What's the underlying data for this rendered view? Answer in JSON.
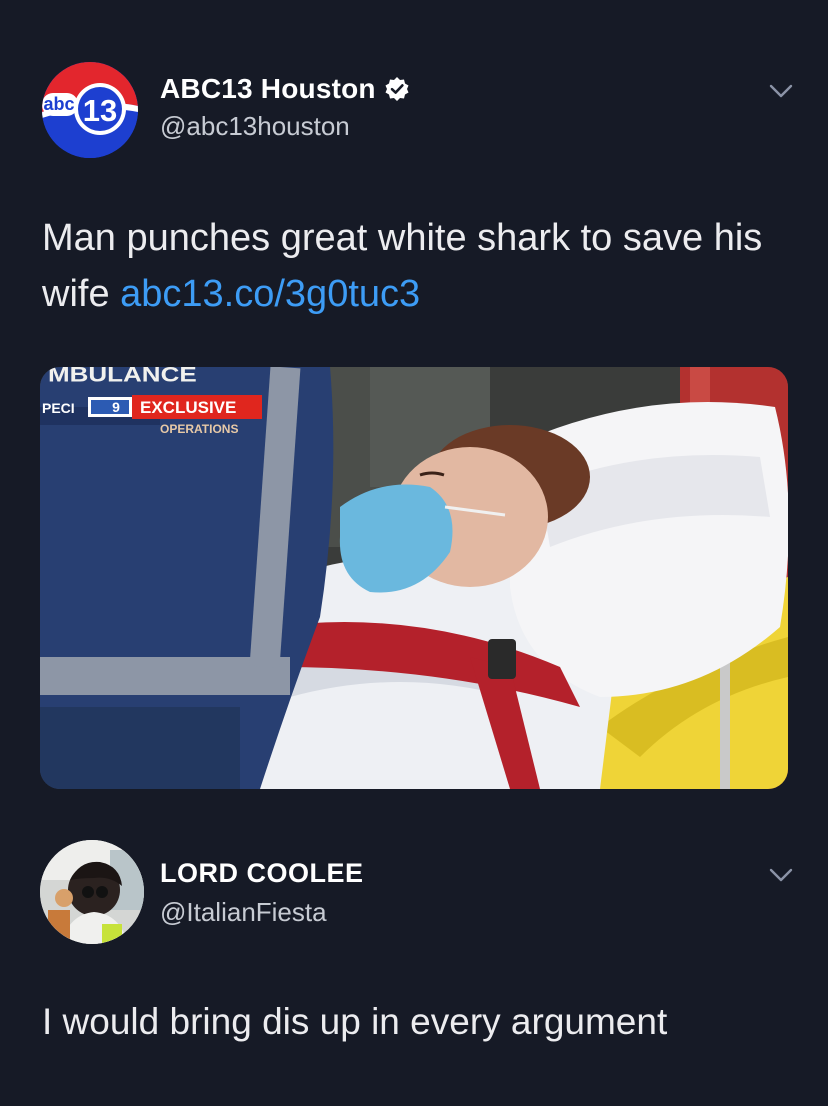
{
  "tweets": [
    {
      "display_name": "ABC13 Houston",
      "handle": "@abc13houston",
      "verified": true,
      "text": "Man punches great white shark to save his wife ",
      "link": "abc13.co/3g0tuc3",
      "avatar": {
        "brand_text": "abc",
        "channel_number": "13",
        "colors": {
          "blue": "#1d3fd0",
          "red": "#e3262d",
          "white": "#ffffff"
        }
      },
      "media": {
        "overlay_top": "MBULANCE",
        "overlay_bottom": "OPERATIONS",
        "overlay_left": "PECI",
        "badge_text": "EXCLUSIVE",
        "channel_logo": "9",
        "colors": {
          "badge_red": "#e0261e",
          "uniform_blue": "#283f72",
          "mask_blue": "#6ab8de",
          "strap_red": "#b4212b",
          "blanket_yellow": "#efd437"
        }
      }
    },
    {
      "display_name": "LORD COOLEE",
      "handle": "@ItalianFiesta",
      "verified": false,
      "text": "I would bring dis up in every argument"
    }
  ],
  "icons": {
    "verified": "verified-badge-icon",
    "more": "chevron-down-icon"
  },
  "colors": {
    "background": "#161a26",
    "text": "#ececef",
    "secondary_text": "#c7cbd3",
    "link": "#3d9cf5",
    "chevron": "#8b93a6"
  }
}
